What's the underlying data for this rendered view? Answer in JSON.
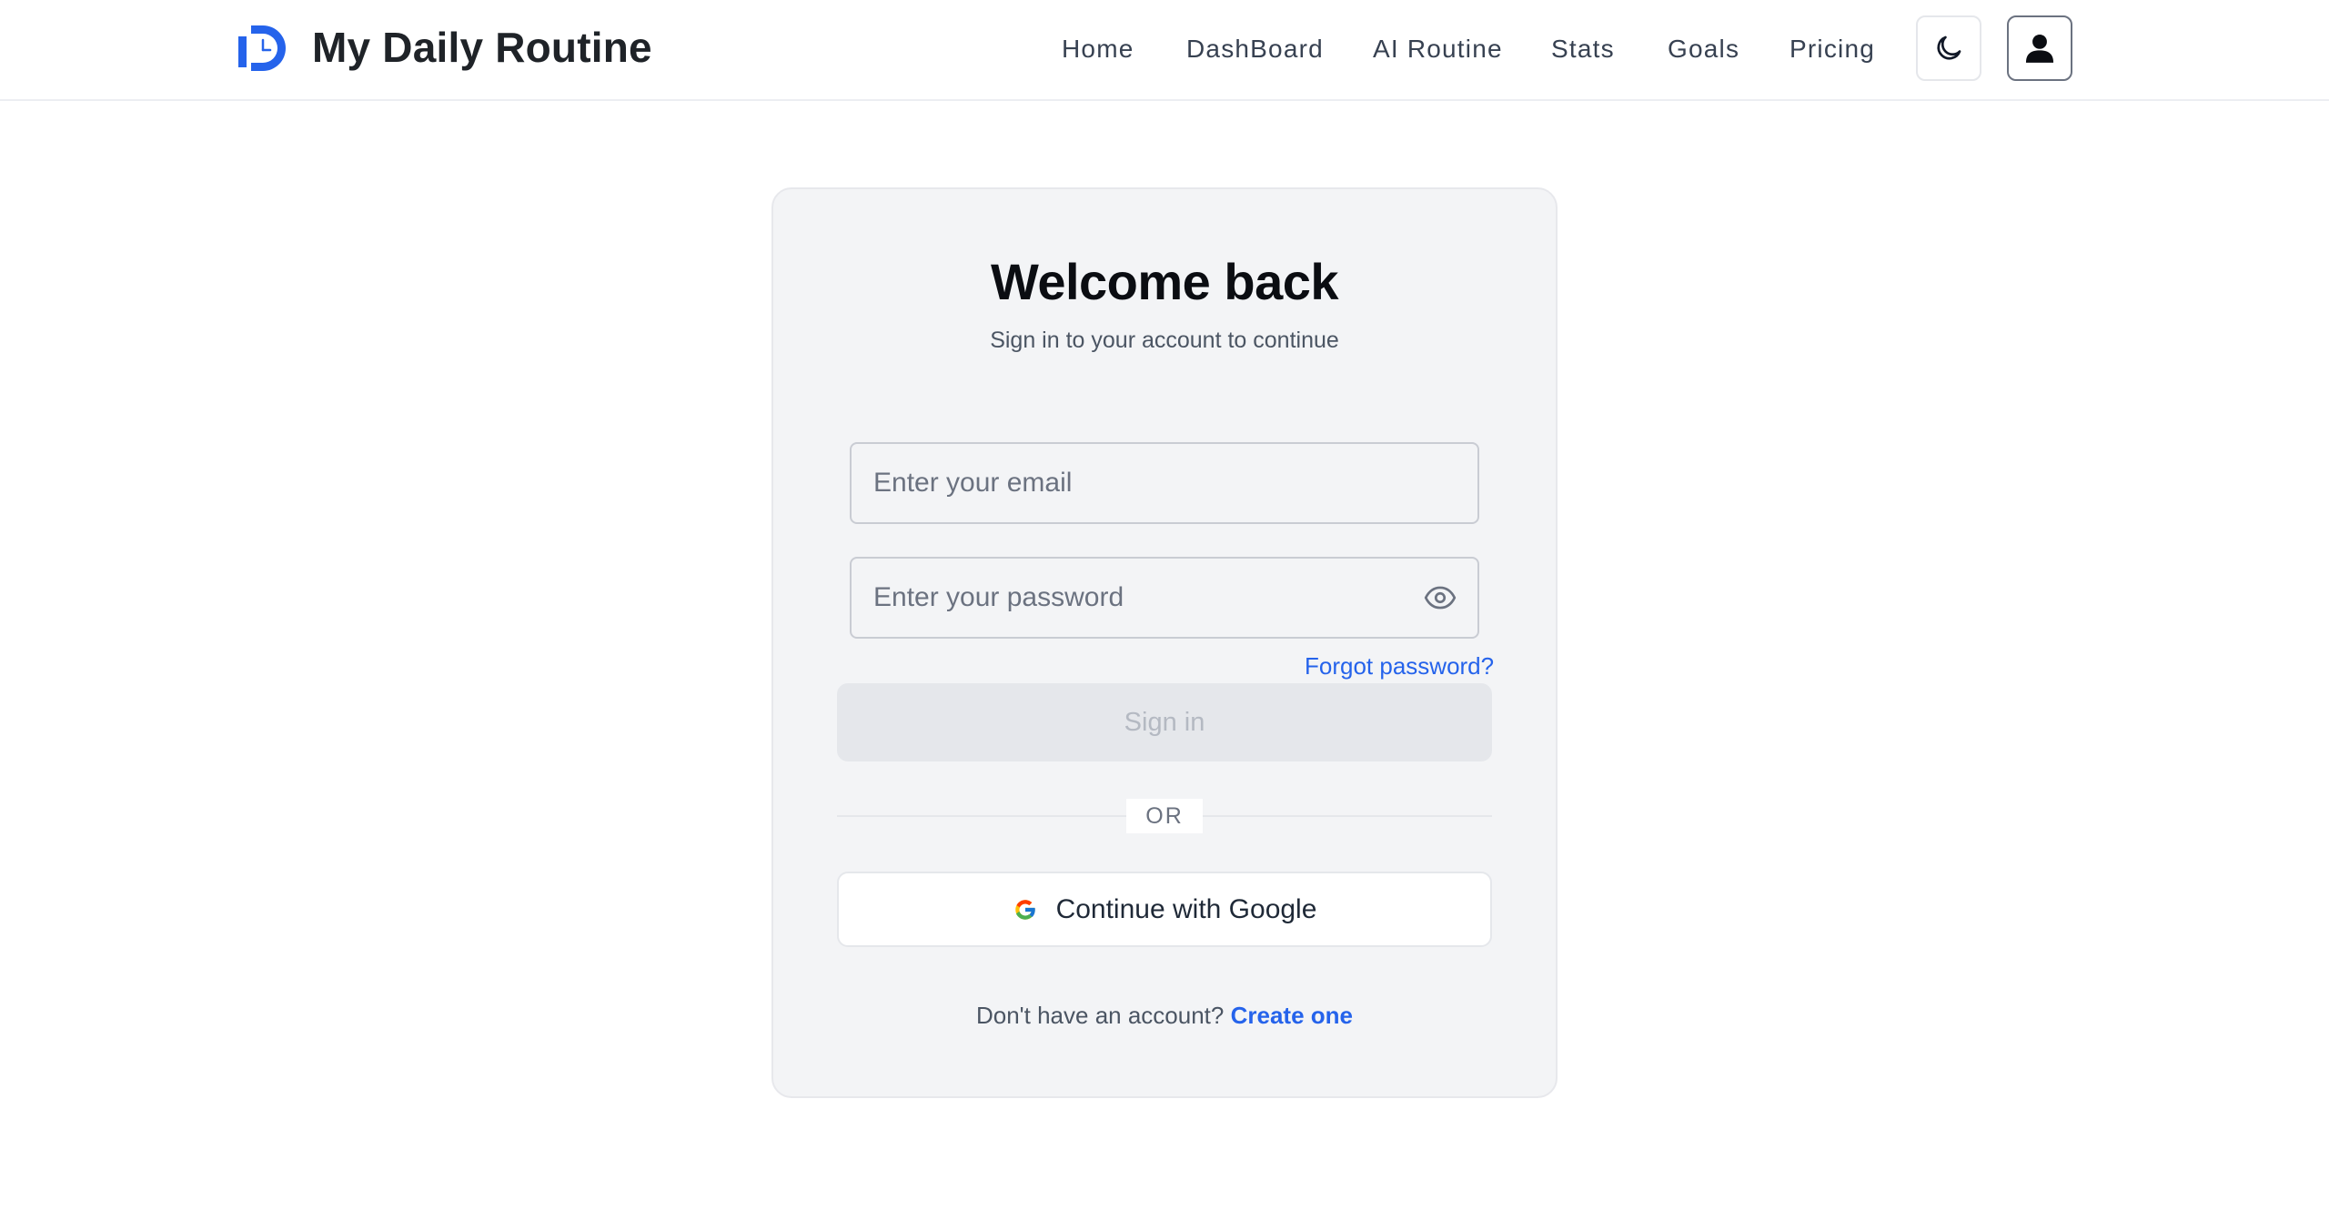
{
  "brand": {
    "name": "My Daily Routine",
    "logo_icon": "clock-d-logo-icon",
    "accent": "#2563eb"
  },
  "nav": {
    "items": [
      {
        "label": "Home"
      },
      {
        "label": "DashBoard"
      },
      {
        "label": "AI Routine"
      },
      {
        "label": "Stats"
      },
      {
        "label": "Goals"
      },
      {
        "label": "Pricing"
      }
    ],
    "theme_toggle_icon": "moon-icon",
    "profile_icon": "user-icon"
  },
  "login": {
    "title": "Welcome back",
    "subtitle": "Sign in to your account to continue",
    "email_placeholder": "Enter your email",
    "email_value": "",
    "password_placeholder": "Enter your password",
    "password_value": "",
    "password_toggle_icon": "eye-icon",
    "forgot_label": "Forgot password?",
    "signin_label": "Sign in",
    "or_label": "OR",
    "google_label": "Continue with Google",
    "google_icon": "google-icon",
    "no_account_text": "Don't have an account?",
    "create_label": "Create one"
  }
}
